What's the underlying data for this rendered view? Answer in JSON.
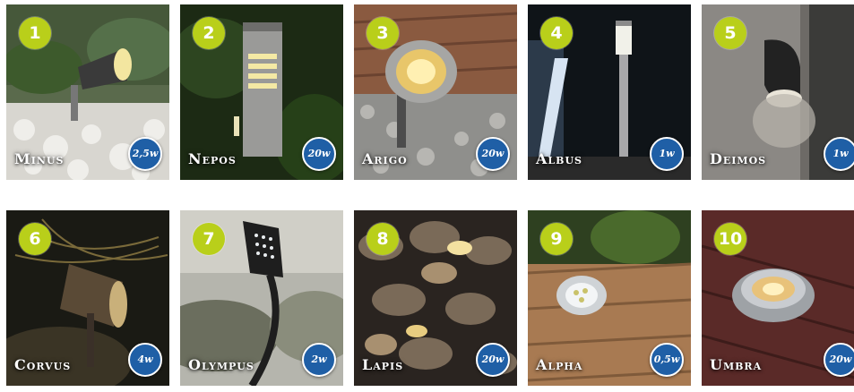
{
  "products": [
    {
      "number": "1",
      "name": "Minus",
      "wattage": "2,5w"
    },
    {
      "number": "2",
      "name": "Nepos",
      "wattage": "20w"
    },
    {
      "number": "3",
      "name": "Arigo",
      "wattage": "20w"
    },
    {
      "number": "4",
      "name": "Albus",
      "wattage": "1w"
    },
    {
      "number": "5",
      "name": "Deimos",
      "wattage": "1w"
    },
    {
      "number": "6",
      "name": "Corvus",
      "wattage": "4w"
    },
    {
      "number": "7",
      "name": "Olympus",
      "wattage": "2w"
    },
    {
      "number": "8",
      "name": "Lapis",
      "wattage": "20w"
    },
    {
      "number": "9",
      "name": "Alpha",
      "wattage": "0,5w"
    },
    {
      "number": "10",
      "name": "Umbra",
      "wattage": "20w"
    }
  ],
  "colors": {
    "number_badge": "#b9cf1a",
    "wattage_badge": "#1f5fa6",
    "label_text": "#ffffff"
  }
}
